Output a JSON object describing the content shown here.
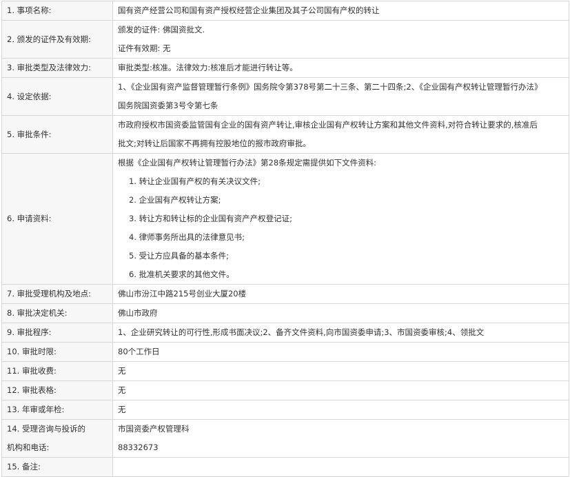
{
  "rows": [
    {
      "label": "1. 事项名称:",
      "lines": [
        "国有资产经营公司和国有资产授权经营企业集团及其子公司国有产权的转让"
      ]
    },
    {
      "label": "2. 颁发的证件及有效期:",
      "lines": [
        "颁发的证件:   佛国资批文.",
        "证件有效期:   无"
      ]
    },
    {
      "label": "3. 审批类型及法律效力:",
      "lines": [
        "审批类型:核准。法律效力:核准后才能进行转让等。"
      ]
    },
    {
      "label": "4. 设定依据:",
      "lines": [
        "1、《企业国有资产监督管理暂行条例》国务院令第378号第二十三条、第二十四条;2、《企业国有产权转让管理暂行办法》",
        "国务院国资委第3号令第七条"
      ]
    },
    {
      "label": "5. 审批条件:",
      "lines": [
        "市政府授权市国资委监管国有企业的国有资产转让,审核企业国有产权转让方案和其他文件资料,对符合转让要求的,核准后",
        "批文;对转让后国家不再拥有控股地位的报市政府审批。"
      ]
    },
    {
      "label": "6. 申请资料:",
      "intro": "根据《企业国有产权转让管理暂行办法》第28条规定需提供如下文件资料:",
      "items": [
        "1. 转让企业国有产权的有关决议文件;",
        "2. 企业国有产权转让方案;",
        "3. 转让方和转让标的企业国有资产产权登记证;",
        "4. 律师事务所出具的法律意见书;",
        "5. 受让方应具备的基本条件;",
        "6. 批准机关要求的其他文件。"
      ]
    },
    {
      "label": "7. 审批受理机构及地点:",
      "lines": [
        "佛山市汾江中路215号创业大厦20楼"
      ]
    },
    {
      "label": "8. 审批决定机关:",
      "lines": [
        "佛山市政府"
      ]
    },
    {
      "label": "9. 审批程序:",
      "lines": [
        "1、企业研究转让的可行性,形成书面决议;2、备齐文件资料,向市国资委申请;3、市国资委审核;4、领批文"
      ]
    },
    {
      "label": "10. 审批时限:",
      "lines": [
        "80个工作日"
      ]
    },
    {
      "label": "11. 审批收费:",
      "lines": [
        "无"
      ]
    },
    {
      "label": "12. 审批表格:",
      "lines": [
        "无"
      ]
    },
    {
      "label": "13. 年审或年检:",
      "lines": [
        "无"
      ]
    },
    {
      "label_lines": [
        "14. 受理咨询与投诉的",
        "机构和电话:"
      ],
      "lines": [
        "市国资委产权管理科",
        "88332673"
      ]
    },
    {
      "label": "15. 备注:",
      "lines": [
        ""
      ]
    }
  ],
  "colors": {
    "label_text": "#b8621a",
    "label_bg": "#f7f7f7",
    "border": "#d6d6d6",
    "value_text": "#333333"
  }
}
